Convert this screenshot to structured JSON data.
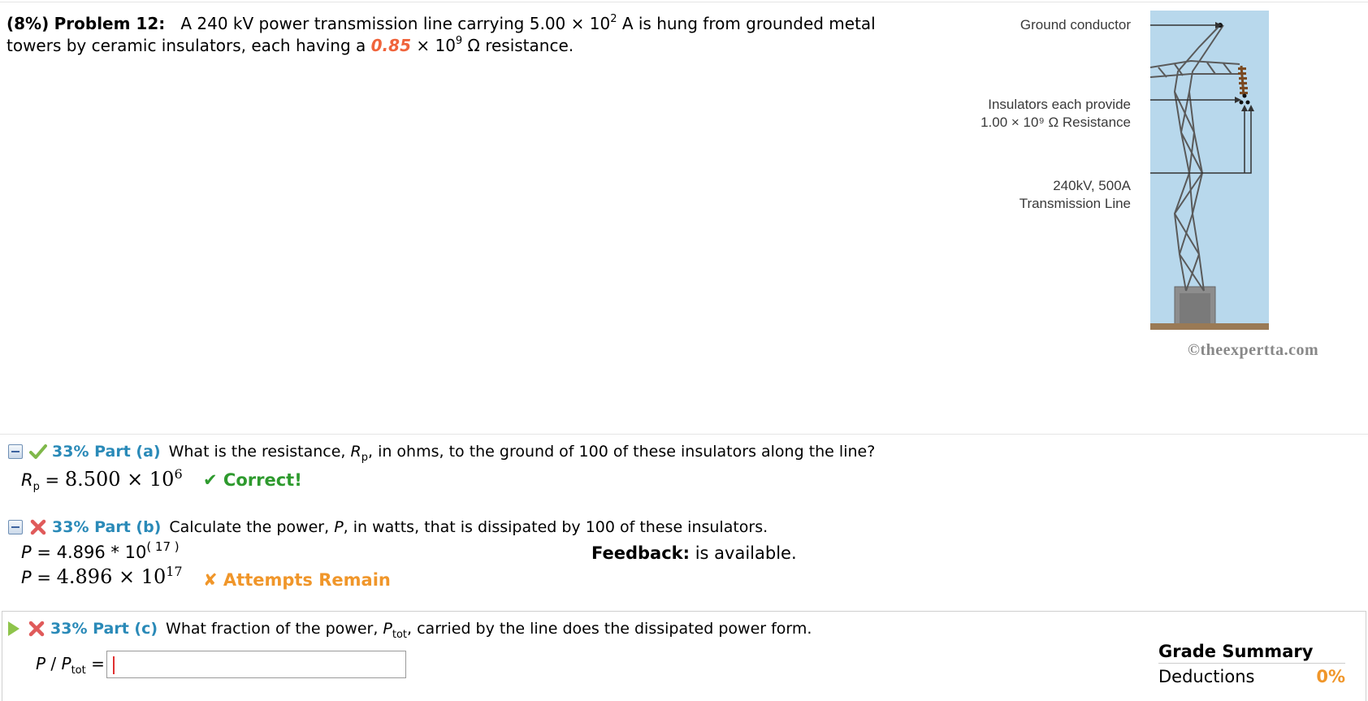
{
  "problem": {
    "weight": "(8%)",
    "label": "Problem 12:",
    "text_1": "A 240 kV power transmission line carrying 5.00 × 10",
    "exp_1": "2",
    "text_2": " A is hung from grounded metal towers by ceramic insulators, each having a ",
    "param": "0.85",
    "text_3": " × 10",
    "exp_2": "9",
    "text_4": " Ω resistance."
  },
  "figure": {
    "ground_conductor": "Ground conductor",
    "insulators_line1": "Insulators each provide",
    "insulators_line2": "1.00 × 10⁹ Ω Resistance",
    "line_label1": "240kV, 500A",
    "line_label2": "Transmission Line",
    "copyright": "©theexpertta.com"
  },
  "parts": {
    "a": {
      "pct": "33% Part (a)",
      "q_before": "What is the resistance, ",
      "q_var": "R",
      "q_sub": "p",
      "q_after": ", in ohms, to the ground of 100 of these insulators along the line?",
      "ans_var": "R",
      "ans_sub": "p",
      "ans_eq": " = ",
      "ans_mant": "8.500 × 10",
      "ans_exp": "6",
      "status": "✔ Correct!",
      "status_icon": "check-icon"
    },
    "b": {
      "pct": "33% Part (b)",
      "q_before": "Calculate the power, ",
      "q_var": "P",
      "q_after": ", in watts, that is dissipated by 100 of these insulators.",
      "raw_var": "P",
      "raw_text": " = 4.896 * 10",
      "raw_exp": "( 17 )",
      "ans_var": "P",
      "ans_eq": " = ",
      "ans_mant": "4.896 × 10",
      "ans_exp": "17",
      "status": "✘ Attempts Remain",
      "feedback_label": "Feedback:",
      "feedback_text": " is available.",
      "status_icon": "x-icon"
    },
    "c": {
      "pct": "33% Part (c)",
      "q_before": "What fraction of the power, ",
      "q_var": "P",
      "q_sub": "tot",
      "q_after": ", carried by the line does the dissipated power form.",
      "input_label_var": "P",
      "input_label_mid": " / ",
      "input_label_var2": "P",
      "input_label_sub": "tot",
      "input_label_eq": " = ",
      "input_value": "",
      "status_icon": "x-icon"
    }
  },
  "grade_summary": {
    "title": "Grade Summary",
    "deductions_label": "Deductions",
    "deductions_value": "0%"
  },
  "colors": {
    "param": "#f0643c",
    "part_label": "#2a8ab8",
    "correct": "#2e9a2e",
    "attempts": "#f0962a"
  }
}
